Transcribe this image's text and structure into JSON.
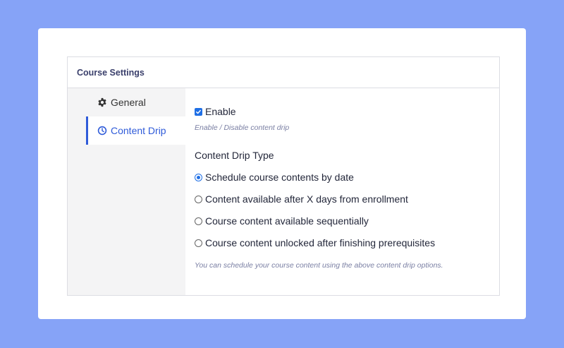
{
  "panel": {
    "title": "Course Settings"
  },
  "sidebar": {
    "items": [
      {
        "label": "General",
        "icon": "gear-icon"
      },
      {
        "label": "Content Drip",
        "icon": "clock-icon",
        "active": true
      }
    ]
  },
  "content": {
    "enable": {
      "label": "Enable",
      "checked": true
    },
    "enable_hint": "Enable / Disable content drip",
    "drip_type_title": "Content Drip Type",
    "options": [
      {
        "label": "Schedule course contents by date",
        "selected": true
      },
      {
        "label": "Content available after X days from enrollment",
        "selected": false
      },
      {
        "label": "Course content available sequentially",
        "selected": false
      },
      {
        "label": "Course content unlocked after finishing prerequisites",
        "selected": false
      }
    ],
    "options_hint": "You can schedule your course content using the above content drip options."
  },
  "colors": {
    "background": "#86a3f7",
    "accent": "#2f5bd9",
    "control": "#1f6fe5"
  }
}
